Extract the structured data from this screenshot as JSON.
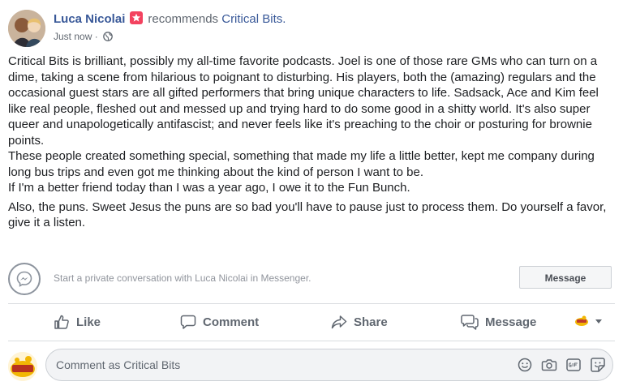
{
  "post": {
    "author_name": "Luca Nicolai",
    "recommends_text": "recommends",
    "page_name": "Critical Bits.",
    "timestamp": "Just now",
    "separator": "·",
    "body_paragraph_1": "Critical Bits is brilliant, possibly my all-time favorite podcasts. Joel is one of those rare GMs who can turn on a dime, taking a scene from hilarious to poignant to disturbing. His players, both the (amazing) regulars and the occasional guest stars are all gifted performers that bring unique characters to life. Sadsack, Ace and Kim feel like real people, fleshed out and messed up and trying hard to do some good in a shitty world. It's also super queer and unapologetically antifascist; and never feels like it's preaching to the choir or posturing for brownie points.",
    "body_paragraph_2": "These people created something special, something that made my life a little better, kept me company during long bus trips and even got me thinking about the kind of person I want to be.",
    "body_paragraph_3": "If I'm a better friend today than I was a year ago, I owe it to the Fun Bunch.",
    "body_paragraph_4": "Also, the puns. Sweet Jesus the puns are so bad you'll have to pause just to process them. Do yourself a favor, give it a listen."
  },
  "messenger": {
    "prompt": "Start a private conversation with Luca Nicolai in Messenger.",
    "button_label": "Message"
  },
  "actions": {
    "like": "Like",
    "comment": "Comment",
    "share": "Share",
    "message": "Message"
  },
  "comment": {
    "placeholder": "Comment as Critical Bits"
  },
  "colors": {
    "link_blue": "#385898",
    "badge_red": "#f3425f",
    "muted_grey": "#606770"
  },
  "icons": [
    "recommend-star-icon",
    "globe-icon",
    "messenger-icon",
    "like-icon",
    "comment-icon",
    "share-icon",
    "message-icon",
    "caret-down-icon",
    "emoji-icon",
    "camera-icon",
    "gif-icon",
    "sticker-icon"
  ]
}
